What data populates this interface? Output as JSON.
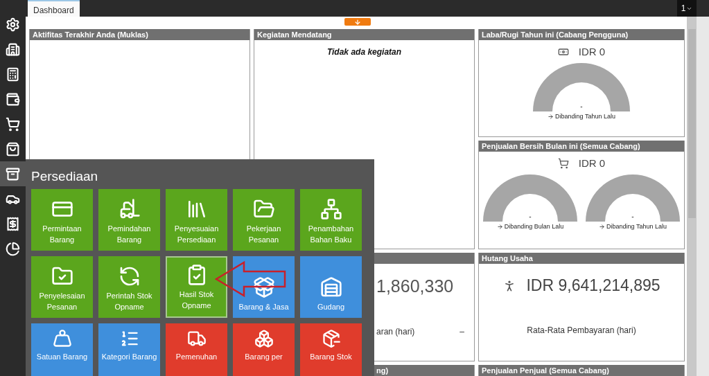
{
  "top_bar": {
    "tabs": [
      {
        "label": "Dashboard",
        "selected": true
      }
    ],
    "page_indicator": "1"
  },
  "sidebar": {
    "items": [
      {
        "selected": false
      },
      {
        "selected": false
      },
      {
        "selected": false
      },
      {
        "selected": false
      },
      {
        "selected": false
      },
      {
        "selected": false
      },
      {
        "selected": true
      },
      {
        "selected": false
      },
      {
        "selected": false
      },
      {
        "selected": false
      }
    ]
  },
  "panels": [
    {
      "kind": "empty",
      "title": "Aktifitas Terakhir Anda (Muklas)"
    },
    {
      "kind": "message",
      "title": "Kegiatan Mendatang",
      "message": "Tidak ada kegiatan"
    },
    {
      "kind": "gauge",
      "title": "Laba/Rugi Tahun ini (Cabang Pengguna)",
      "amount": "IDR 0",
      "gauges": [
        {
          "value": "-",
          "caption": "Dibanding Tahun Lalu"
        }
      ]
    },
    {
      "kind": "gauge",
      "title": "Penjualan Bersih Bulan ini (Semua Cabang)",
      "amount": "IDR 0",
      "gauges": [
        {
          "value": "-",
          "caption": "Dibanding Bulan Lalu"
        },
        {
          "value": "-",
          "caption": "Dibanding Tahun Lalu"
        }
      ]
    },
    {
      "kind": "partial",
      "amount": "1,860,330",
      "caption": "aran (hari)",
      "value": "–"
    },
    {
      "kind": "amount",
      "title": "Hutang Usaha",
      "amount": "IDR 9,641,214,895",
      "caption": "Rata-Rata Pembayaran (hari)"
    },
    {
      "kind": "partial",
      "title": "ng)"
    },
    {
      "kind": "amount",
      "title": "Penjualan Penjual (Semua Cabang)"
    }
  ],
  "menu": {
    "title": "Persediaan",
    "tiles": [
      {
        "label": "Permintaan Barang",
        "color": "#5ba61d",
        "selected": false
      },
      {
        "label": "Pemindahan Barang",
        "color": "#5ba61d",
        "selected": false
      },
      {
        "label": "Penyesuaian Persediaan",
        "color": "#5ba61d",
        "selected": false
      },
      {
        "label": "Pekerjaan Pesanan",
        "color": "#5ba61d",
        "selected": false
      },
      {
        "label": "Penambahan Bahan Baku",
        "color": "#5ba61d",
        "selected": false
      },
      {
        "label": "Penyelesaian Pesanan",
        "color": "#5ba61d",
        "selected": false
      },
      {
        "label": "Perintah Stok Opname",
        "color": "#5ba61d",
        "selected": false
      },
      {
        "label": "Hasil Stok Opname",
        "color": "#5ba61d",
        "selected": true
      },
      {
        "label": "Barang & Jasa",
        "color": "#3f8fdc",
        "selected": false
      },
      {
        "label": "Gudang",
        "color": "#3f8fdc",
        "selected": false
      },
      {
        "label": "Satuan Barang",
        "color": "#3f8fdc",
        "selected": false
      },
      {
        "label": "Kategori Barang",
        "color": "#3f8fdc",
        "selected": false
      },
      {
        "label": "Pemenuhan",
        "color": "#e03c2c",
        "selected": false
      },
      {
        "label": "Barang per",
        "color": "#e03c2c",
        "selected": false
      },
      {
        "label": "Barang Stok",
        "color": "#e03c2c",
        "selected": false
      }
    ]
  }
}
